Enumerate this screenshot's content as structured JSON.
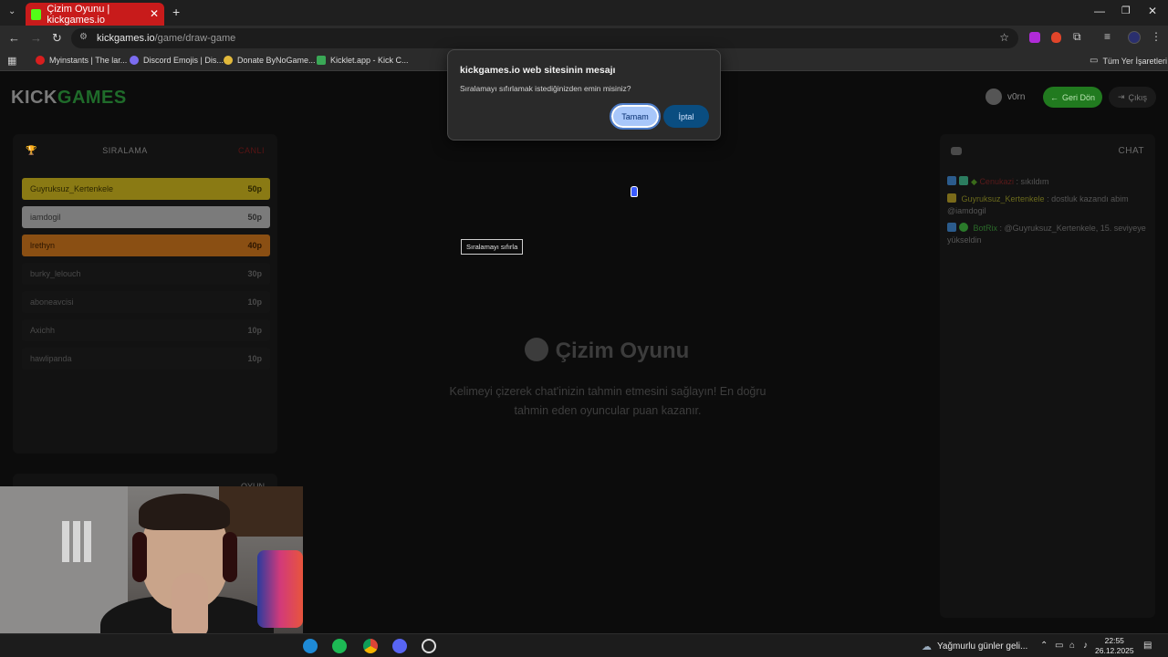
{
  "browser": {
    "tab_title": "Çizim Oyunu | kickgames.io",
    "tab_close": "✕",
    "new_tab": "+",
    "url_host": "kickgames.io",
    "url_path": "/game/draw-game",
    "bookmarks": [
      "Myinstants | The lar...",
      "Discord Emojis | Dis...",
      "Donate ByNoGame...",
      "Kicklet.app - Kick C..."
    ],
    "all_bookmarks": "Tüm Yer İşaretleri"
  },
  "header": {
    "logo_kick": "KICK",
    "logo_games": "GAMES",
    "username": "v0rn",
    "back_label": "Geri Dön",
    "logout_label": "Çıkış"
  },
  "leaderboard": {
    "title": "SIRALAMA",
    "live_label": "CANLI",
    "rows": [
      {
        "name": "Guyruksuz_Kertenkele",
        "points": "50p",
        "bg": "#8a7a14",
        "fg": "#2c2600"
      },
      {
        "name": "iamdogil",
        "points": "50p",
        "bg": "#7b7b7b",
        "fg": "#2a2a2a"
      },
      {
        "name": "lrethyn",
        "points": "40p",
        "bg": "#8a4f13",
        "fg": "#2c1500"
      },
      {
        "name": "burky_lelouch",
        "points": "30p",
        "bg": "#141414",
        "fg": "#4a4a4a"
      },
      {
        "name": "aboneavcisi",
        "points": "10p",
        "bg": "#141414",
        "fg": "#4a4a4a"
      },
      {
        "name": "Axichh",
        "points": "10p",
        "bg": "#141414",
        "fg": "#4a4a4a"
      },
      {
        "name": "hawlipanda",
        "points": "10p",
        "bg": "#141414",
        "fg": "#4a4a4a"
      }
    ],
    "second_panel_title": "OYUN"
  },
  "main": {
    "title": "Çizim Oyunu",
    "description": "Kelimeyi çizerek chat'inizin tahmin etmesini sağlayın! En doğru tahmin eden oyuncular puan kazanır.",
    "tooltip": "Sıralamayı sıfırla"
  },
  "chat": {
    "title": "CHAT",
    "messages": [
      {
        "user": "Cenukazi",
        "text": "sıkıldım",
        "user_color": "#5a1a1a"
      },
      {
        "user": "Guyruksuz_Kertenkele",
        "text": "dostluk kazandı abim @iamdogil",
        "user_color": "#6b6a1c"
      },
      {
        "user": "BotRix",
        "text": "@Guyruksuz_Kertenkele, 15. seviyeye yükseldin",
        "user_color": "#2b6b2a"
      }
    ]
  },
  "dialog": {
    "title": "kickgames.io web sitesinin mesajı",
    "message": "Sıralamayı sıfırlamak istediğinizden emin misiniz?",
    "ok_label": "Tamam",
    "cancel_label": "İptal"
  },
  "taskbar": {
    "weather": "Yağmurlu günler geli...",
    "time": "22:55",
    "date": "26.12.2025"
  }
}
